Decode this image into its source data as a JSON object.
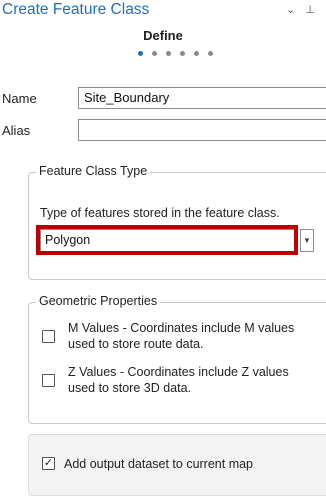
{
  "pane": {
    "title": "Create Feature Class",
    "controls": {
      "dropdown": "⌄",
      "pin": "⊥",
      "close": "⋮"
    }
  },
  "wizard": {
    "step_title": "Define",
    "steps_total": 6,
    "active_step": 1
  },
  "fields": {
    "name_label": "Name",
    "name_value": "Site_Boundary",
    "alias_label": "Alias",
    "alias_value": ""
  },
  "feature_class_type": {
    "legend": "Feature Class Type",
    "description": "Type of features stored in the feature class.",
    "selected": "Polygon",
    "highlight_color": "#c00000"
  },
  "geometric_properties": {
    "legend": "Geometric Properties",
    "m_values": {
      "checked": false,
      "line1": "M Values - Coordinates include M values",
      "line2": "used to store route data."
    },
    "z_values": {
      "checked": false,
      "line1": "Z Values - Coordinates include Z values",
      "line2": "used to store 3D data."
    }
  },
  "output": {
    "add_to_map_checked": true,
    "add_to_map_label": "Add output dataset to current map"
  },
  "colors": {
    "accent": "#1b6fc2",
    "highlight": "#c00000"
  }
}
